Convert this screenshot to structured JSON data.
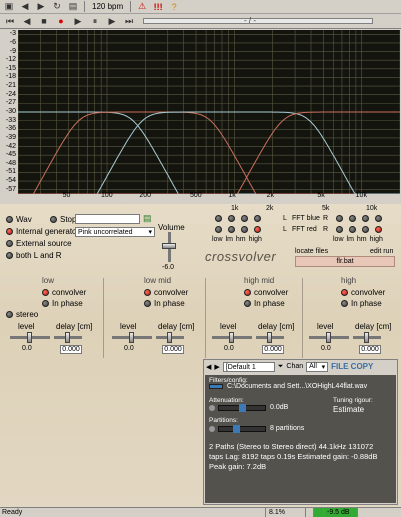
{
  "toolbar": {
    "bpm_label": "120 bpm",
    "position_label": "- / -"
  },
  "plot": {
    "y_ticks": [
      "-3",
      "-6",
      "-9",
      "-12",
      "-15",
      "-18",
      "-21",
      "-24",
      "-27",
      "-30",
      "-33",
      "-36",
      "-39",
      "-42",
      "-45",
      "-48",
      "-51",
      "-54",
      "-57"
    ],
    "x_ticks": [
      "50",
      "100",
      "200",
      "500",
      "1k",
      "2k",
      "5k",
      "10k"
    ]
  },
  "colors": {
    "plot_bg": "#14140e",
    "grid": "#5a5842",
    "low_curve": "#c8705a",
    "high_curve": "#a8ccd4",
    "led_on": "#d42a1c"
  },
  "sources": {
    "wav": "Wav",
    "stop": "Stop",
    "internal_generator": "Internal generator",
    "generator_value": "Pink uncorrelated",
    "external_source": "External source",
    "both_lr": "both L and R",
    "volume_label": "Volume",
    "volume_value": "-6.0"
  },
  "fft": {
    "top_labels": [
      "1k",
      "2k",
      "5k",
      "10k"
    ],
    "blue_label": "FFT blue",
    "red_label": "FFT red",
    "l_label": "L",
    "r_label": "R",
    "band_labels": [
      "low",
      "lm",
      "hm",
      "high"
    ],
    "locate_files": "locate files",
    "edit_run": "edit run",
    "bat_file": "flr.bat"
  },
  "brand": "crossvolver",
  "bands": [
    {
      "title": "low",
      "convolver": "convolver",
      "in_phase": "In phase",
      "level_label": "level",
      "delay_label": "delay [cm]",
      "level_value": "0.0",
      "delay_value": "0.000"
    },
    {
      "title": "low mid",
      "convolver": "convolver",
      "in_phase": "In phase",
      "level_label": "level",
      "delay_label": "delay [cm]",
      "level_value": "0.0",
      "delay_value": "0.000"
    },
    {
      "title": "high mid",
      "convolver": "convolver",
      "in_phase": "In phase",
      "level_label": "level",
      "delay_label": "delay [cm]",
      "level_value": "0.0",
      "delay_value": "0.000"
    },
    {
      "title": "high",
      "convolver": "convolver",
      "in_phase": "In phase",
      "level_label": "level",
      "delay_label": "delay [cm]",
      "level_value": "0.0",
      "delay_value": "0.000"
    }
  ],
  "stereo_label": "stereo",
  "filter": {
    "preset": "[Default 1",
    "chan_label": "Chan",
    "chan_value": "All",
    "file_copy": "FILE COPY",
    "filter_config_label": "Filters/config:",
    "filter_path": "C:\\Documents and Sett...\\XOHighL44flat.wav",
    "attenuation_label": "Attenuation:",
    "attenuation_value": "0.0dB",
    "tuning_label": "Tuning rigour:",
    "tuning_value": "Estimate",
    "partitions_label": "Partitions:",
    "partitions_value": "8 partitions",
    "info_line1": "2 Paths (Stereo to Stereo direct) 44.1kHz 131072",
    "info_line2": "taps Lag: 8192 taps 0.19s Estimated gain: -0.88dB",
    "info_line3": "Peak gain: 7.2dB"
  },
  "status": {
    "ready": "Ready",
    "cpu": "8.1%",
    "level": "-9.5 dB"
  }
}
